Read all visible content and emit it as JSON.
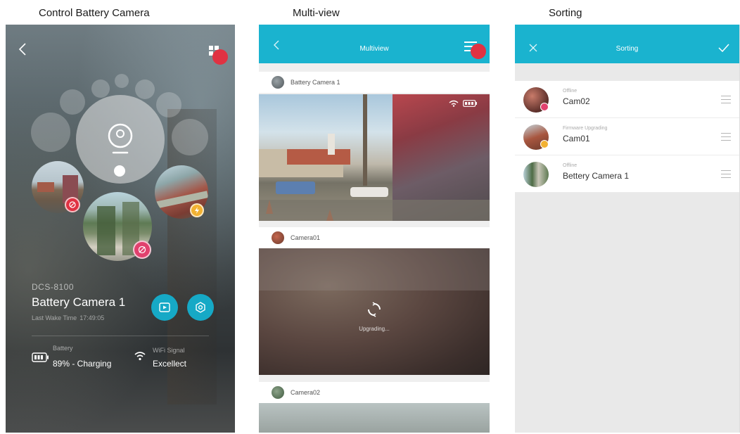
{
  "captions": {
    "control": "Control Battery Camera",
    "multiview": "Multi-view",
    "sorting": "Sorting"
  },
  "control_screen": {
    "back_icon": "chevron-left-icon",
    "layout_icon": "grid-icon",
    "model": "DCS-8100",
    "camera_name": "Battery Camera 1",
    "last_wake_label": "Last Wake Time",
    "last_wake_time": "17:49:05",
    "battery_label": "Battery",
    "battery_value": "89% - Charging",
    "wifi_label": "WiFi Signal",
    "wifi_value": "Excellect",
    "colors": {
      "accent": "#16a9c6",
      "alert": "#e03242",
      "warning": "#f2b132"
    }
  },
  "multiview_screen": {
    "title": "Multiview",
    "sections": [
      {
        "label": "Battery Camera 1"
      },
      {
        "label": "Camera01",
        "status": "Upgrading..."
      },
      {
        "label": "Camera02"
      }
    ],
    "colors": {
      "topbar": "#1ab3cf"
    }
  },
  "sorting_screen": {
    "title": "Sorting",
    "close_icon": "close-icon",
    "confirm_icon": "check-icon",
    "rows": [
      {
        "status": "Offline",
        "name": "Cam02"
      },
      {
        "status": "Firmware Upgrading",
        "name": "Cam01"
      },
      {
        "status": "Offline",
        "name": "Bettery Camera 1"
      }
    ]
  }
}
